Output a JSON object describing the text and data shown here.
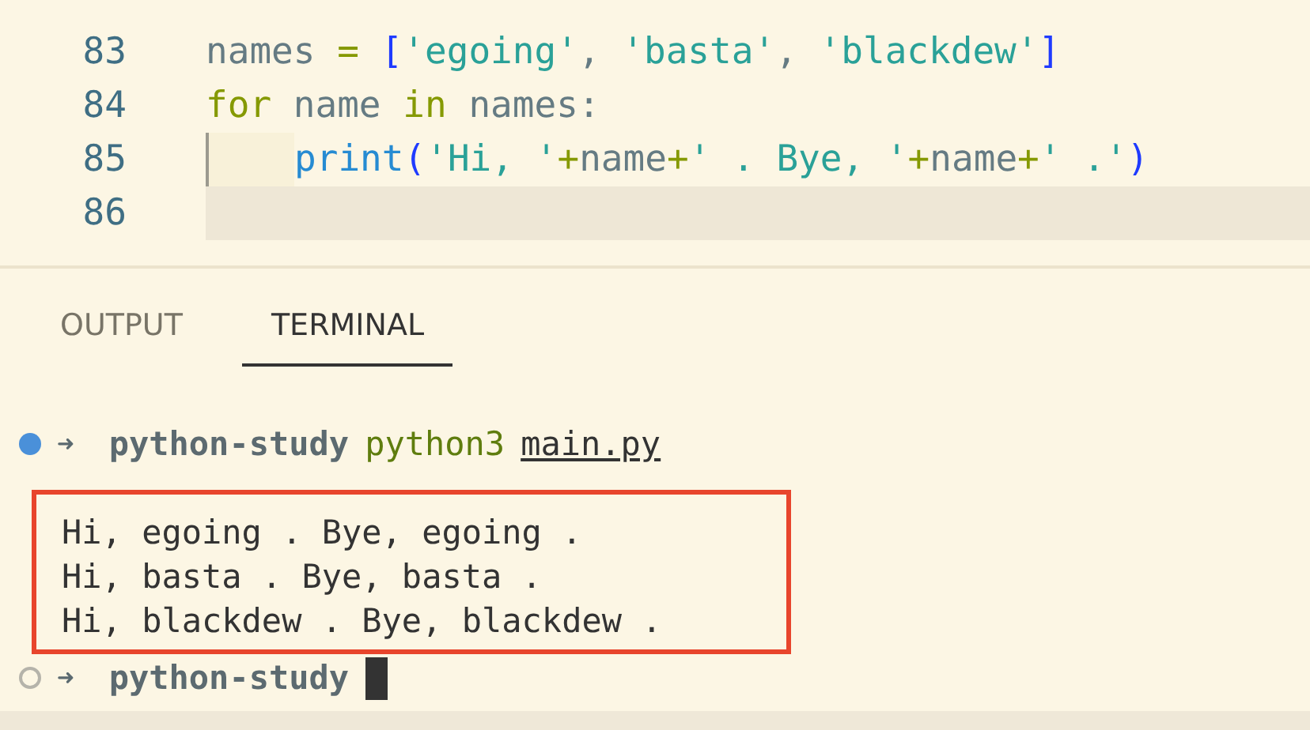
{
  "editor": {
    "lines": [
      {
        "number": "83",
        "tokens": [
          {
            "kind": "plain",
            "text": "names "
          },
          {
            "kind": "op",
            "text": "="
          },
          {
            "kind": "bracket",
            "text": " ["
          },
          {
            "kind": "string",
            "text": "'egoing'"
          },
          {
            "kind": "plain",
            "text": ", "
          },
          {
            "kind": "string",
            "text": "'basta'"
          },
          {
            "kind": "plain",
            "text": ", "
          },
          {
            "kind": "string",
            "text": "'blackdew'"
          },
          {
            "kind": "bracket",
            "text": "]"
          }
        ]
      },
      {
        "number": "84",
        "tokens": [
          {
            "kind": "keyword",
            "text": "for"
          },
          {
            "kind": "plain",
            "text": " name "
          },
          {
            "kind": "keyword",
            "text": "in"
          },
          {
            "kind": "plain",
            "text": " names:"
          }
        ]
      },
      {
        "number": "85",
        "indent": true,
        "tokens": [
          {
            "kind": "func",
            "text": "print"
          },
          {
            "kind": "bracket",
            "text": "("
          },
          {
            "kind": "string",
            "text": "'Hi, '"
          },
          {
            "kind": "op",
            "text": "+"
          },
          {
            "kind": "plain",
            "text": "name"
          },
          {
            "kind": "op",
            "text": "+"
          },
          {
            "kind": "string",
            "text": "' . Bye, '"
          },
          {
            "kind": "op",
            "text": "+"
          },
          {
            "kind": "plain",
            "text": "name"
          },
          {
            "kind": "op",
            "text": "+"
          },
          {
            "kind": "string",
            "text": "' .'"
          },
          {
            "kind": "bracket",
            "text": ")"
          }
        ]
      },
      {
        "number": "86",
        "current": true
      }
    ]
  },
  "panel": {
    "tabs": [
      {
        "label": "OUTPUT",
        "selected": false
      },
      {
        "label": "TERMINAL",
        "selected": true
      }
    ]
  },
  "terminal": {
    "lines": [
      {
        "kind": "prompt",
        "finished": true,
        "arrow": "➜",
        "dir": "python-study",
        "command": "python3",
        "arg": "main.py"
      },
      {
        "kind": "output",
        "highlighted": true,
        "lines": [
          "Hi, egoing . Bye, egoing .",
          "Hi, basta . Bye, basta .",
          "Hi, blackdew . Bye, blackdew ."
        ]
      },
      {
        "kind": "prompt",
        "finished": false,
        "arrow": "➜",
        "dir": "python-study",
        "cursor": true
      }
    ]
  }
}
